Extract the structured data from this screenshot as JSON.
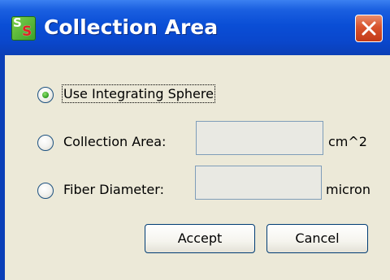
{
  "window": {
    "title": "Collection Area",
    "app_icon_glyphs": [
      "S",
      "S"
    ],
    "close_icon": "close-x-icon",
    "colors": {
      "titlebar": "#0a4ed6",
      "close_button": "#d8532d",
      "client_background": "#ece9d8",
      "radio_selected_dot": "#2f9a1f"
    }
  },
  "options": [
    {
      "label": "Use Integrating Sphere",
      "selected": true
    },
    {
      "label": "Collection Area:",
      "selected": false,
      "input_value": "",
      "unit": "cm^2"
    },
    {
      "label": "Fiber Diameter:",
      "selected": false,
      "input_value": "",
      "unit": "micron"
    }
  ],
  "buttons": {
    "accept": "Accept",
    "cancel": "Cancel"
  }
}
